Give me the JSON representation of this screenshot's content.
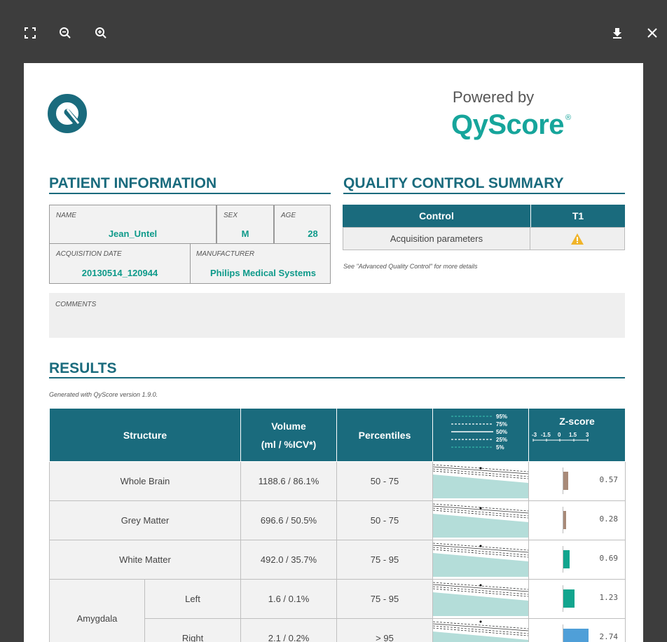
{
  "toolbar": {
    "fullscreen_icon": "fullscreen-icon",
    "zoom_out_icon": "zoom-out-icon",
    "zoom_in_icon": "zoom-in-icon",
    "download_icon": "download-icon",
    "close_icon": "close-icon"
  },
  "header": {
    "powered_by": "Powered by",
    "brand": "QyScore",
    "registered": "®"
  },
  "patient": {
    "title": "PATIENT INFORMATION",
    "name_label": "NAME",
    "name": "Jean_Untel",
    "sex_label": "SEX",
    "sex": "M",
    "age_label": "AGE",
    "age": "28",
    "acq_label": "ACQUISITION DATE",
    "acq": "20130514_120944",
    "manu_label": "MANUFACTURER",
    "manu": "Philips Medical Systems",
    "comments_label": "COMMENTS"
  },
  "qc": {
    "title": "QUALITY CONTROL SUMMARY",
    "col_control": "Control",
    "col_t1": "T1",
    "row_label": "Acquisition parameters",
    "row_status": "warning",
    "note": "See \"Advanced Quality Control\" for more details"
  },
  "results": {
    "title": "RESULTS",
    "generated": "Generated with QyScore version 1.9.0.",
    "col_structure": "Structure",
    "col_volume": "Volume",
    "col_volume_unit": "(ml / %ICV*)",
    "col_percentiles": "Percentiles",
    "legend": [
      "95%",
      "75%",
      "50%",
      "25%",
      "5%"
    ],
    "col_zscore": "Z-score",
    "z_ticks": [
      "-3",
      "-1.5",
      "0",
      "1.5",
      "3"
    ],
    "rows": [
      {
        "structure": "Whole Brain",
        "volume": "1188.6 / 86.1%",
        "percentile": "50 - 75",
        "z": "0.57",
        "zcolor": "#a88a78"
      },
      {
        "structure": "Grey Matter",
        "volume": "696.6 / 50.5%",
        "percentile": "50 - 75",
        "z": "0.28",
        "zcolor": "#a88a78"
      },
      {
        "structure": "White Matter",
        "volume": "492.0 / 35.7%",
        "percentile": "75 - 95",
        "z": "0.69",
        "zcolor": "#12a58e"
      },
      {
        "structure": "Amygdala",
        "side": "Left",
        "volume": "1.6 / 0.1%",
        "percentile": "75 - 95",
        "z": "1.23",
        "zcolor": "#12a58e"
      },
      {
        "structure": "Amygdala",
        "side": "Right",
        "volume": "2.1 / 0.2%",
        "percentile": "> 95",
        "z": "2.74",
        "zcolor": "#4f9fd8"
      }
    ]
  }
}
